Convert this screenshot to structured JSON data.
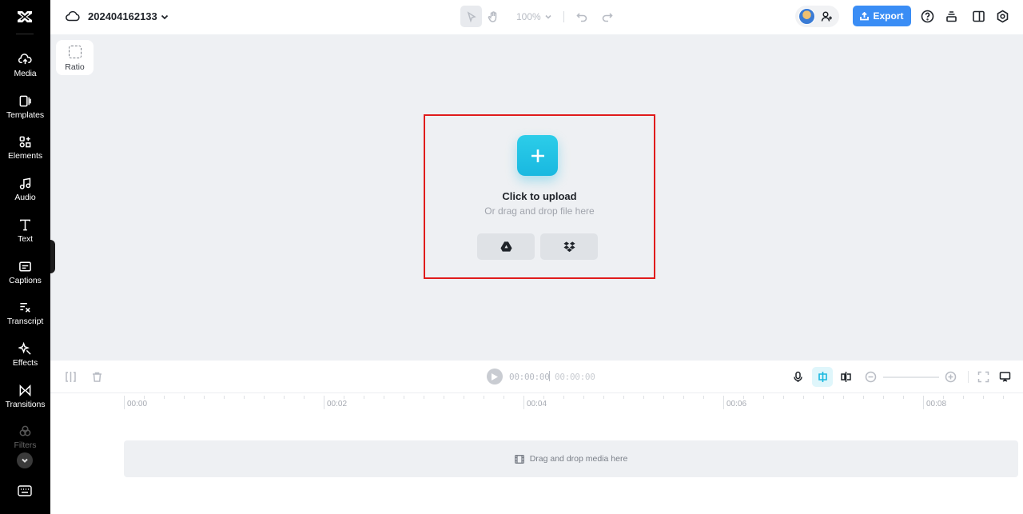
{
  "sidebar": {
    "items": [
      {
        "label": "Media",
        "icon": "media-upload-icon"
      },
      {
        "label": "Templates",
        "icon": "templates-icon"
      },
      {
        "label": "Elements",
        "icon": "elements-icon"
      },
      {
        "label": "Audio",
        "icon": "music-note-icon"
      },
      {
        "label": "Text",
        "icon": "text-icon"
      },
      {
        "label": "Captions",
        "icon": "captions-icon"
      },
      {
        "label": "Transcript",
        "icon": "transcript-icon"
      },
      {
        "label": "Effects",
        "icon": "effects-icon"
      },
      {
        "label": "Transitions",
        "icon": "transitions-icon"
      },
      {
        "label": "Filters",
        "icon": "filters-icon"
      }
    ]
  },
  "header": {
    "project_name": "202404162133",
    "zoom": "100%",
    "export_label": "Export"
  },
  "canvas": {
    "ratio_label": "Ratio",
    "upload_title": "Click to upload",
    "upload_subtitle": "Or drag and drop file here",
    "highlight_color": "#e01b1b",
    "accent_color": "#19b8e0"
  },
  "timeline": {
    "current_time": "00:00:00",
    "total_time": "00:00:00",
    "ruler_labels": [
      "00:00",
      "00:02",
      "00:04",
      "00:06",
      "00:08"
    ],
    "drop_text": "Drag and drop media here"
  },
  "colors": {
    "export_button": "#3a8df5",
    "sidebar_bg": "#000000",
    "canvas_bg": "#eef0f3"
  }
}
